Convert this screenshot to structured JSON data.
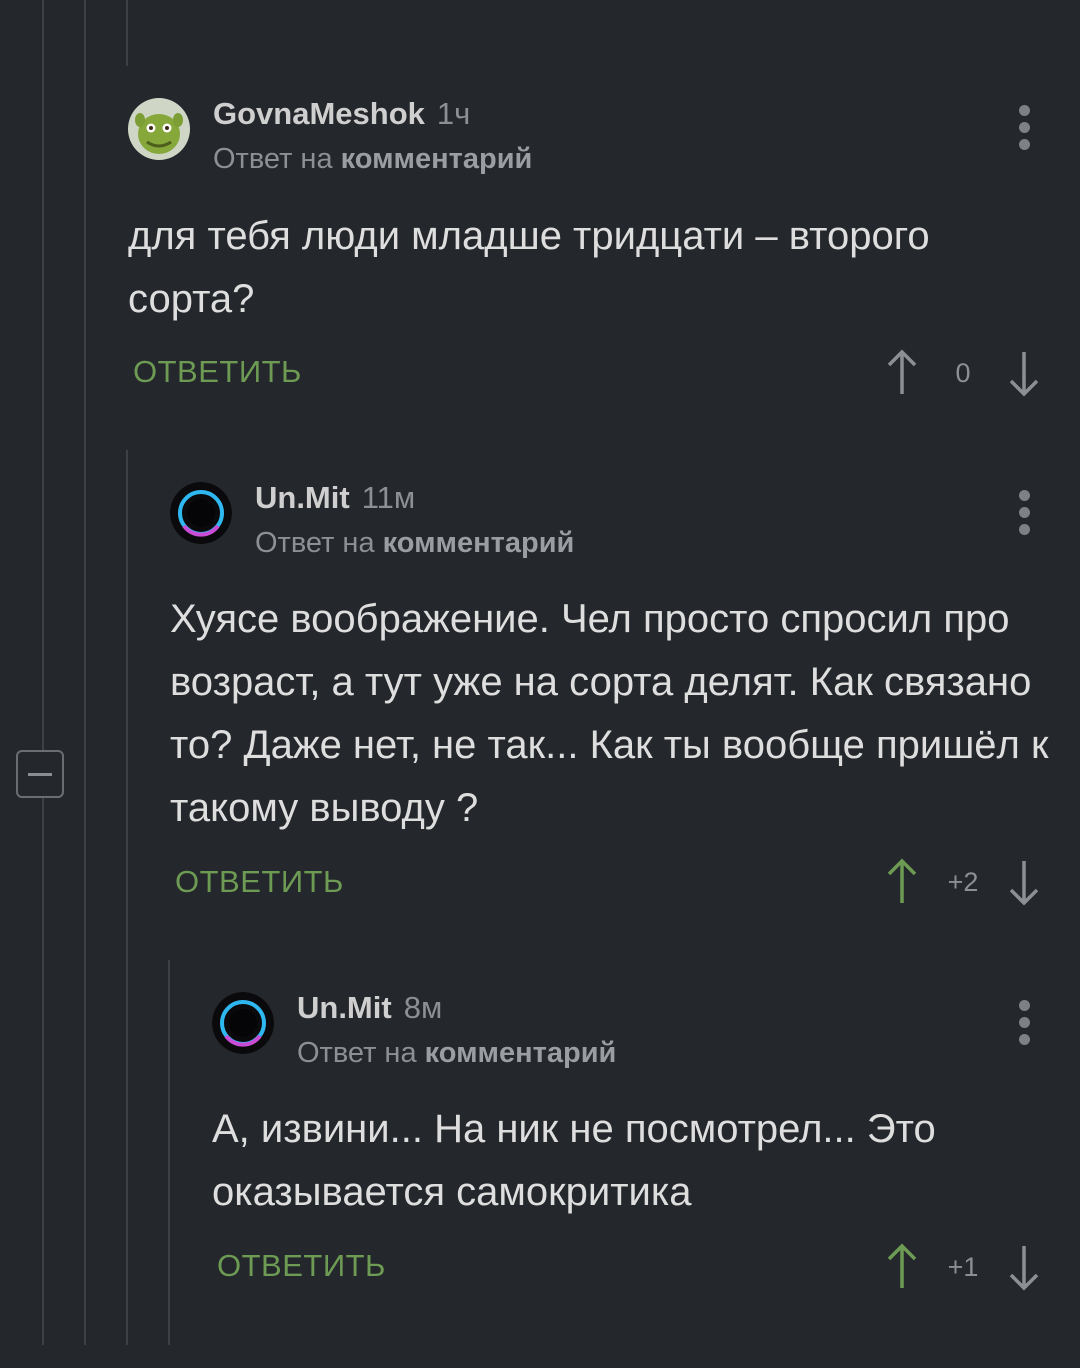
{
  "comments": [
    {
      "username": "GovnaMeshok",
      "time": "1ч",
      "reply_prefix": "Ответ на",
      "reply_link": "комментарий",
      "text": "для тебя люди младше тридцати – второго сорта?",
      "reply_label": "ОТВЕТИТЬ",
      "score": "0",
      "upvoted": false
    },
    {
      "username": "Un.Mit",
      "time": "11м",
      "reply_prefix": "Ответ на",
      "reply_link": "комментарий",
      "text": "Хуясе воображение. Чел просто спросил про возраст, а тут уже на сорта делят. Как связано то? Даже нет, не так... Как ты вообще пришёл к такому выводу ?",
      "reply_label": "ОТВЕТИТЬ",
      "score": "+2",
      "upvoted": true
    },
    {
      "username": "Un.Mit",
      "time": "8м",
      "reply_prefix": "Ответ на",
      "reply_link": "комментарий",
      "text": "А, извини... На ник не посмотрел... Это оказывается самокритика",
      "reply_label": "ОТВЕТИТЬ",
      "score": "+1",
      "upvoted": true
    }
  ],
  "colors": {
    "background": "#24272b",
    "accent_green": "#6d9b53",
    "text_muted": "#8c8f93",
    "thread_line": "#3d4146"
  }
}
